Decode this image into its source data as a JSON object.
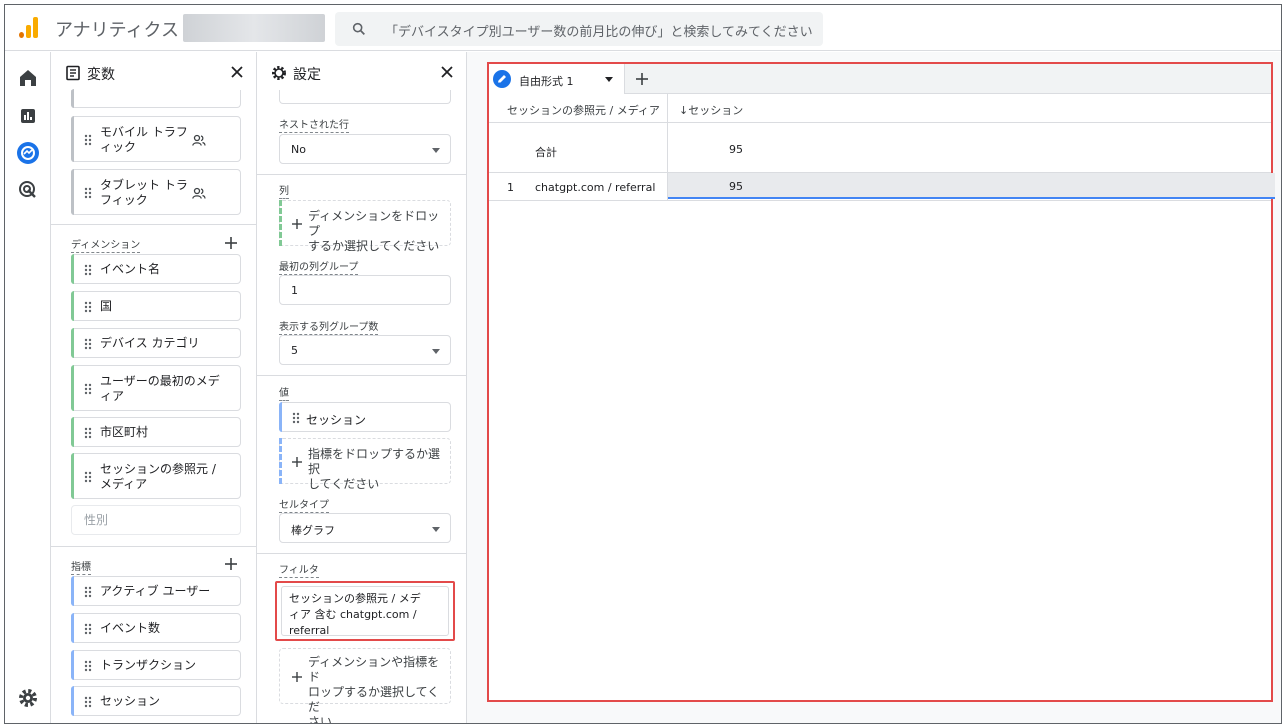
{
  "app": {
    "title": "アナリティクス",
    "search_placeholder": "「デバイスタイプ別ユーザー数の前月比の伸び」と検索してみてください"
  },
  "variables_panel": {
    "title": "変数",
    "segments": [
      {
        "label_line1": "モバイル トラフ",
        "label_line2": "ィック"
      },
      {
        "label_line1": "タブレット トラ",
        "label_line2": "フィック"
      }
    ],
    "dimensions_label": "ディメンション",
    "dimensions": [
      {
        "line1": "イベント名",
        "line2": ""
      },
      {
        "line1": "国",
        "line2": ""
      },
      {
        "line1": "デバイス カテゴリ",
        "line2": ""
      },
      {
        "line1": "ユーザーの最初のメデ",
        "line2": "ィア"
      },
      {
        "line1": "市区町村",
        "line2": ""
      },
      {
        "line1": "セッションの参照元 /",
        "line2": "メディア"
      }
    ],
    "dimension_placeholder": "性別",
    "metrics_label": "指標",
    "metrics": [
      "アクティブ ユーザー",
      "イベント数",
      "トランザクション",
      "セッション"
    ]
  },
  "settings_panel": {
    "title": "設定",
    "nested_rows_label": "ネストされた行",
    "nested_rows_value": "No",
    "columns_label": "列",
    "columns_drop_line1": "ディメンションをドロップ",
    "columns_drop_line2": "するか選択してください",
    "first_col_group_label": "最初の列グループ",
    "first_col_group_value": "1",
    "col_groups_count_label": "表示する列グループ数",
    "col_groups_count_value": "5",
    "values_label": "値",
    "value_chip": "セッション",
    "values_drop_line1": "指標をドロップするか選択",
    "values_drop_line2": "してください",
    "cell_type_label": "セルタイプ",
    "cell_type_value": "棒グラフ",
    "filters_label": "フィルタ",
    "filter_line1": "セッションの参照元 / メデ",
    "filter_line2": "ィア 含む chatgpt.com /",
    "filter_line3": "referral",
    "filters_drop_line1": "ディメンションや指標をド",
    "filters_drop_line2": "ロップするか選択してくだ",
    "filters_drop_line3": "さい"
  },
  "canvas": {
    "tab_label": "自由形式 1",
    "col_dimension": "セッションの参照元 / メディア",
    "col_metric": "↓セッション",
    "total_label": "合計",
    "total_value": "95",
    "rows": [
      {
        "index": "1",
        "dimension": "chatgpt.com / referral",
        "value": "95"
      }
    ]
  },
  "colors": {
    "accent_red": "#e34a4a",
    "dimension_green": "#81c995",
    "metric_blue": "#8ab4f8",
    "active_blue": "#1a73e8"
  }
}
